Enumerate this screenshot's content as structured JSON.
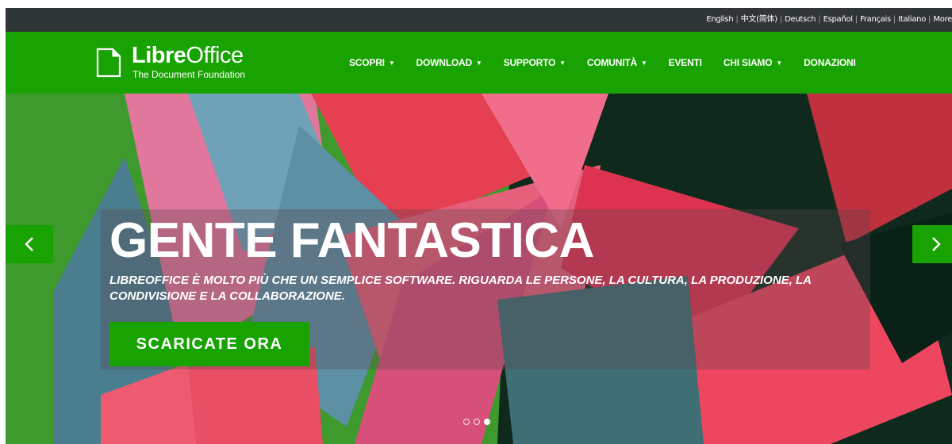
{
  "language_bar": {
    "languages": [
      "English",
      "中文(简体)",
      "Deutsch",
      "Español",
      "Français",
      "Italiano",
      "More"
    ]
  },
  "header": {
    "logo_name_bold": "Libre",
    "logo_name_regular": "Office",
    "logo_subtitle": "The Document Foundation",
    "nav": [
      {
        "label": "SCOPRI",
        "dropdown": true
      },
      {
        "label": "DOWNLOAD",
        "dropdown": true
      },
      {
        "label": "SUPPORTO",
        "dropdown": true
      },
      {
        "label": "COMUNITÀ",
        "dropdown": true
      },
      {
        "label": "EVENTI",
        "dropdown": false
      },
      {
        "label": "CHI SIAMO",
        "dropdown": true
      },
      {
        "label": "DONAZIONI",
        "dropdown": false
      }
    ],
    "brand_color": "#18a303"
  },
  "hero": {
    "headline": "GENTE FANTASTICA",
    "subline": "LIBREOFFICE È MOLTO PIÙ CHE UN SEMPLICE SOFTWARE. RIGUARDA LE PERSONE, LA CULTURA, LA PRODUZIONE, LA CONDIVISIONE E LA COLLABORAZIONE.",
    "cta_label": "SCARICATE ORA",
    "prev_icon": "chevron-left-icon",
    "next_icon": "chevron-right-icon",
    "slides_total": 3,
    "active_slide": 3
  }
}
